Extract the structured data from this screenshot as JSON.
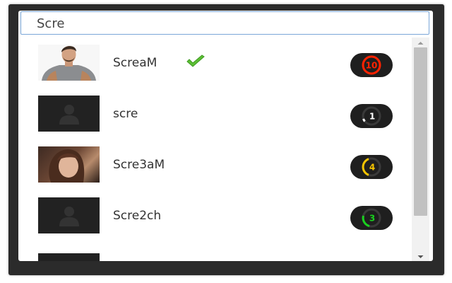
{
  "search": {
    "value": "Scre"
  },
  "results": [
    {
      "name": "ScreaM",
      "verified": true,
      "level": "10",
      "level_color": "#ff2200",
      "avatar": "man-photo"
    },
    {
      "name": "scre",
      "verified": false,
      "level": "1",
      "level_color": "#ffffff",
      "avatar": "placeholder"
    },
    {
      "name": "Scre3aM",
      "verified": false,
      "level": "4",
      "level_color": "#f5c400",
      "avatar": "woman-photo"
    },
    {
      "name": "Scre2ch",
      "verified": false,
      "level": "3",
      "level_color": "#19d11e",
      "avatar": "placeholder"
    },
    {
      "name": "",
      "verified": false,
      "level": "",
      "level_color": "#ffffff",
      "avatar": "placeholder"
    }
  ],
  "icons": {
    "verified": "checkmark-icon",
    "scroll_up": "arrow-up-icon",
    "scroll_down": "arrow-down-icon",
    "placeholder": "user-silhouette-icon"
  }
}
